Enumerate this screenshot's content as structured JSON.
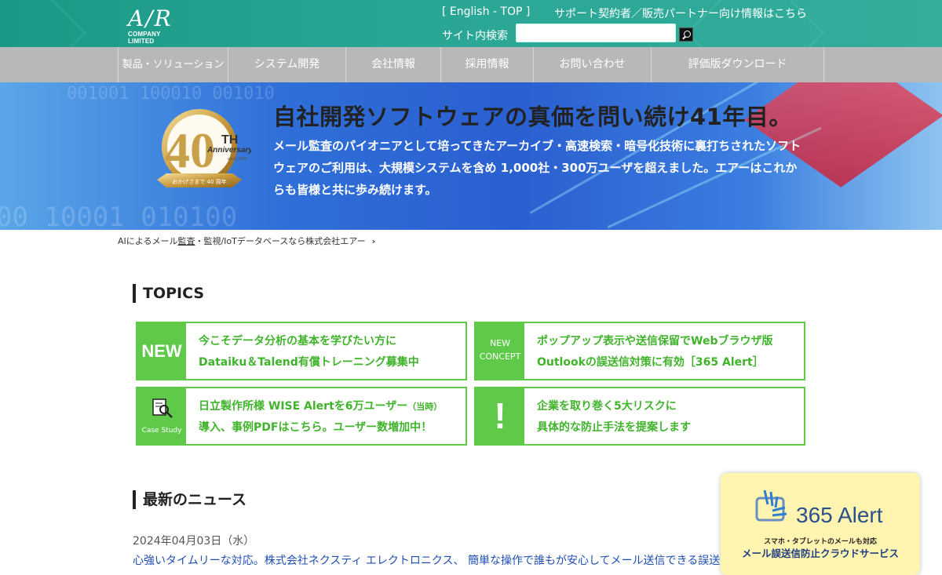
{
  "header": {
    "logo_text": "A/R",
    "logo_sub": "COMPANY LIMITED",
    "english_link": "[ English - TOP ]",
    "partner_link": "サポート契約者／販売パートナー向け情報はこちら",
    "search_label": "サイト内検索",
    "search_value": "",
    "search_button_icon": "search-icon"
  },
  "nav": {
    "items": [
      {
        "label": "製品・ソリューション"
      },
      {
        "label": "システム開発"
      },
      {
        "label": "会社情報"
      },
      {
        "label": "採用情報"
      },
      {
        "label": "お問い合わせ"
      },
      {
        "label": "評価版ダウンロード"
      }
    ]
  },
  "hero": {
    "badge_number": "40",
    "badge_th": "TH",
    "badge_anniversary": "Anniversary",
    "badge_since": "since 1983",
    "badge_ribbon": "おかげさまで 40 周年",
    "title": "自社開発ソフトウェアの真価を問い続け41年目。",
    "body": "メール監査のパイオニアとして培ってきたアーカイブ・高速検索・暗号化技術に裏打ちされたソフトウェアのご利用は、大規模システムを含め 1,000社・300万ユーザを超えました。エアーはこれからも皆様と共に歩み続けます。",
    "bg_binary_1": "001001 100010 001010",
    "bg_binary_2": "00 10001 010100"
  },
  "breadcrumb": {
    "prefix": "AIによるメール",
    "link": "監査",
    "rest": "・監視/IoTデータベースなら株式会社エアー",
    "chevron": "›"
  },
  "topics": {
    "heading": "TOPICS",
    "cards": [
      {
        "tag": "NEW",
        "line1": "今こそデータ分析の基本を学びたい方に",
        "line2": "Dataiku＆Talend有償トレーニング募集中",
        "icon": "new-label"
      },
      {
        "tag_line1": "NEW",
        "tag_line2": "CONCEPT",
        "line1": "ポップアップ表示や送信保留でWebブラウザ版",
        "line2": "Outlookの誤送信対策に有効［365 Alert］",
        "icon": "new-concept-label"
      },
      {
        "tag": "Case Study",
        "line1": "日立製作所様 WISE Alertを6万ユーザー",
        "line1_note": "（当時）",
        "line2": "導入、事例PDFはこちら。ユーザー数増加中！",
        "icon": "case-study-icon"
      },
      {
        "tag": "!",
        "line1": "企業を取り巻く5大リスクに",
        "line2": "具体的な防止手法を提案します",
        "icon": "exclamation-icon"
      }
    ],
    "accent_color": "#5fca49"
  },
  "news": {
    "heading": "最新のニュース",
    "items": [
      {
        "date": "2024年04月03日（水）",
        "title": "心強いタイムリーな対応。株式会社ネクスティ エレクトロニクス、 簡単な操作で誰もが安心してメール送信できる誤送信対策"
      }
    ]
  },
  "ad": {
    "title": "365 Alert",
    "sub": "スマホ・タブレットのメールも対応",
    "main": "メール誤送信防止クラウドサービス",
    "icon": "alert-logo-icon"
  },
  "colors": {
    "header_bg": "#2aa695",
    "nav_bg": "#b8b8b8",
    "link": "#1f4fb3",
    "green": "#5fca49"
  }
}
